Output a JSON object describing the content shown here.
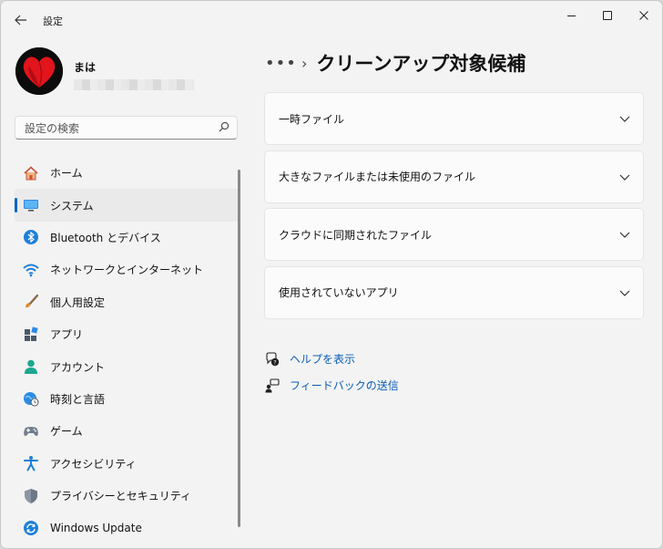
{
  "window": {
    "title": "設定"
  },
  "user": {
    "name": "まは"
  },
  "search": {
    "placeholder": "設定の検索"
  },
  "sidebar": {
    "items": [
      {
        "label": "ホーム",
        "icon": "home-icon"
      },
      {
        "label": "システム",
        "icon": "monitor-icon",
        "active": true
      },
      {
        "label": "Bluetooth とデバイス",
        "icon": "bluetooth-icon"
      },
      {
        "label": "ネットワークとインターネット",
        "icon": "wifi-icon"
      },
      {
        "label": "個人用設定",
        "icon": "paintbrush-icon"
      },
      {
        "label": "アプリ",
        "icon": "apps-icon"
      },
      {
        "label": "アカウント",
        "icon": "account-icon"
      },
      {
        "label": "時刻と言語",
        "icon": "globe-clock-icon"
      },
      {
        "label": "ゲーム",
        "icon": "gamepad-icon"
      },
      {
        "label": "アクセシビリティ",
        "icon": "accessibility-icon"
      },
      {
        "label": "プライバシーとセキュリティ",
        "icon": "shield-icon"
      },
      {
        "label": "Windows Update",
        "icon": "update-icon"
      }
    ]
  },
  "header": {
    "more": "•••",
    "separator": "›",
    "title": "クリーンアップ対象候補"
  },
  "main": {
    "cards": [
      {
        "label": "一時ファイル"
      },
      {
        "label": "大きなファイルまたは未使用のファイル"
      },
      {
        "label": "クラウドに同期されたファイル"
      },
      {
        "label": "使用されていないアプリ"
      }
    ],
    "links": [
      {
        "label": "ヘルプを表示",
        "icon": "help-icon"
      },
      {
        "label": "フィードバックの送信",
        "icon": "feedback-icon"
      }
    ]
  },
  "colors": {
    "accent": "#0067c0",
    "link": "#0a5db6"
  }
}
